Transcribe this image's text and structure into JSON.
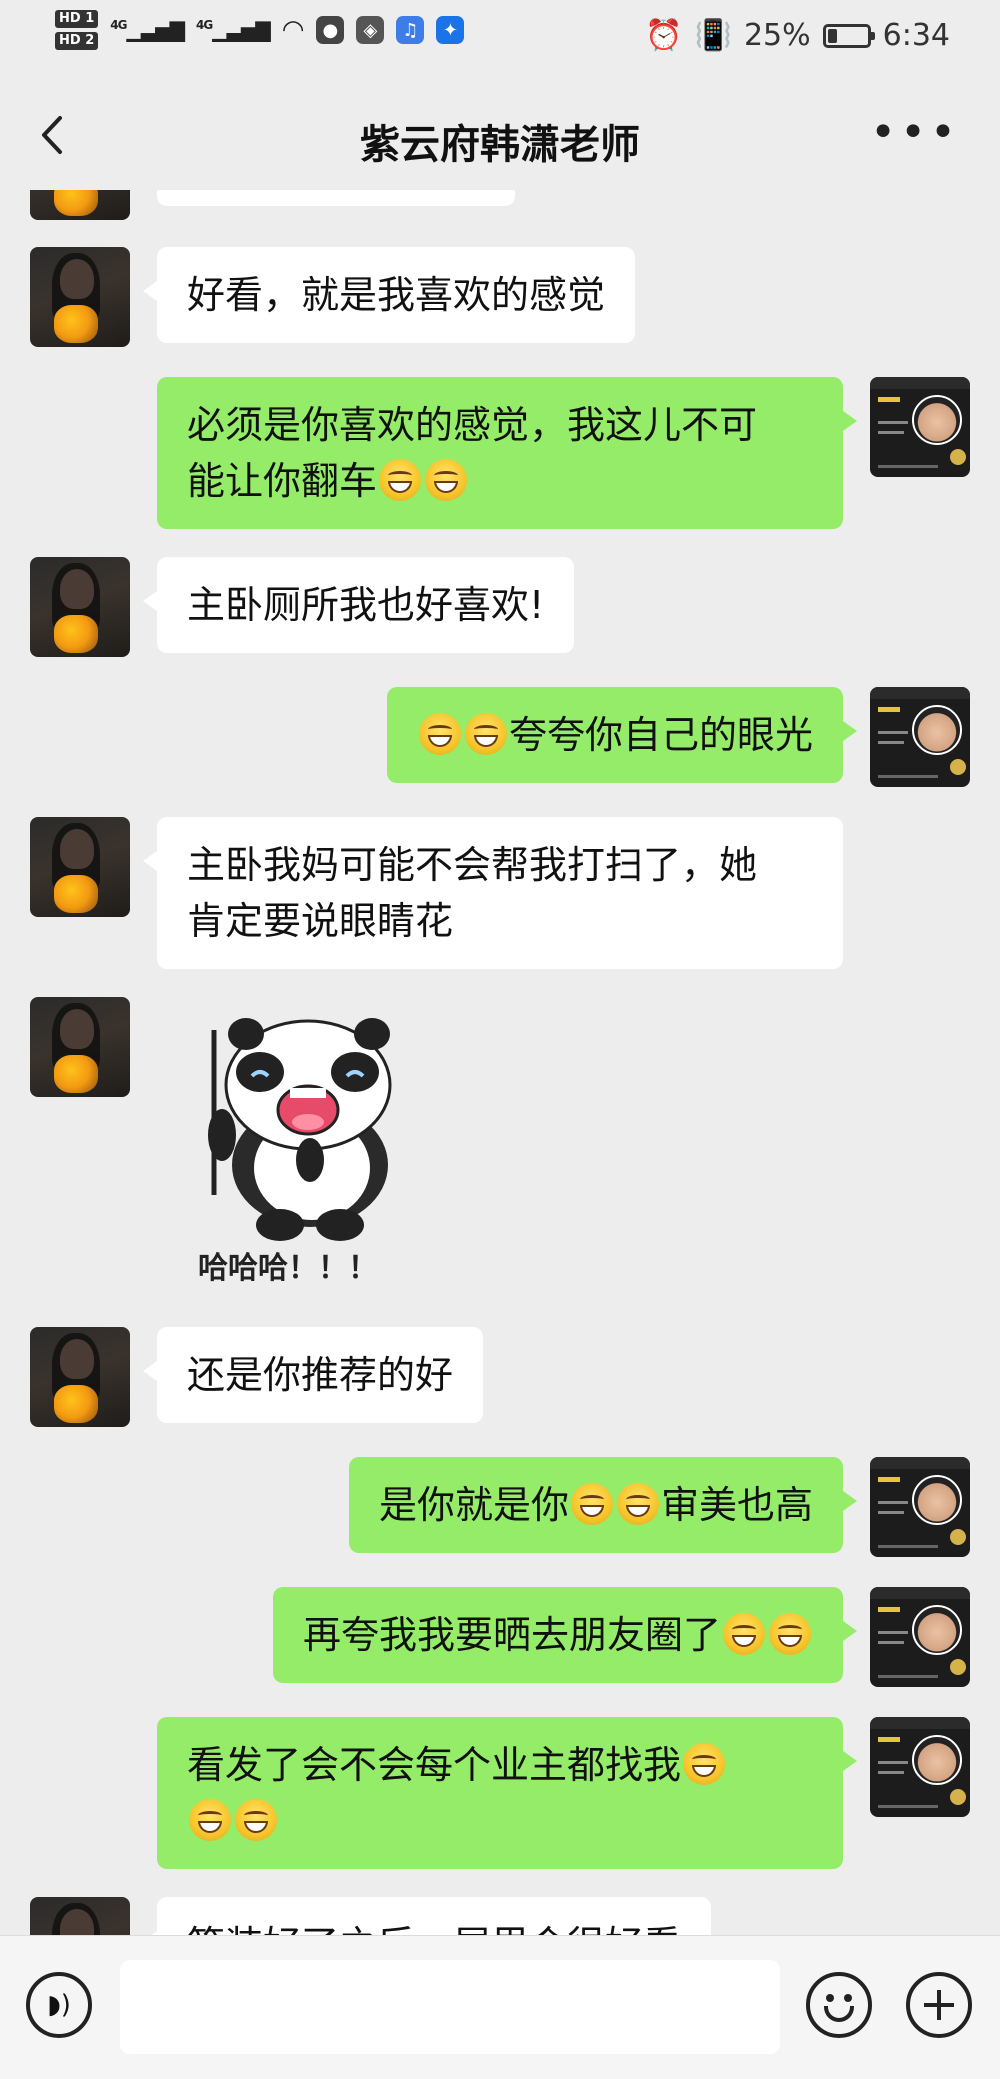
{
  "status_bar": {
    "hd1": "HD 1",
    "hd2": "HD 2",
    "net1": "4G",
    "net2": "4G",
    "battery_percent": "25%",
    "battery_level": 0.25,
    "time": "6:34"
  },
  "header": {
    "title": "紫云府韩潇老师"
  },
  "messages": [
    {
      "from": "her",
      "text": "好看，就是我喜欢的感觉"
    },
    {
      "from": "me",
      "line1": "必须是你喜欢的感觉，我这儿不可",
      "line2": "能让你翻车"
    },
    {
      "from": "her",
      "text": "主卧厕所我也好喜欢!"
    },
    {
      "from": "me",
      "text": "夸夸你自己的眼光"
    },
    {
      "from": "her",
      "line1": "主卧我妈可能不会帮我打扫了，她",
      "line2": "肯定要说眼睛花"
    },
    {
      "from": "her",
      "sticker_caption": "哈哈哈！！！"
    },
    {
      "from": "her",
      "text": "还是你推荐的好"
    },
    {
      "from": "me",
      "part1": "是你就是你",
      "part2": "审美也高"
    },
    {
      "from": "me",
      "text": "再夸我我要晒去朋友圈了"
    },
    {
      "from": "me",
      "text": "看发了会不会每个业主都找我"
    },
    {
      "from": "her",
      "text": "等装好了之后，屋里会很好看"
    }
  ],
  "icons": {
    "grin_emoji": "grinning-face",
    "tears_emoji": "face-with-tears-of-joy"
  },
  "input": {
    "placeholder": ""
  },
  "colors": {
    "incoming_bubble": "#ffffff",
    "outgoing_bubble": "#95ec69",
    "background": "#ededed"
  }
}
